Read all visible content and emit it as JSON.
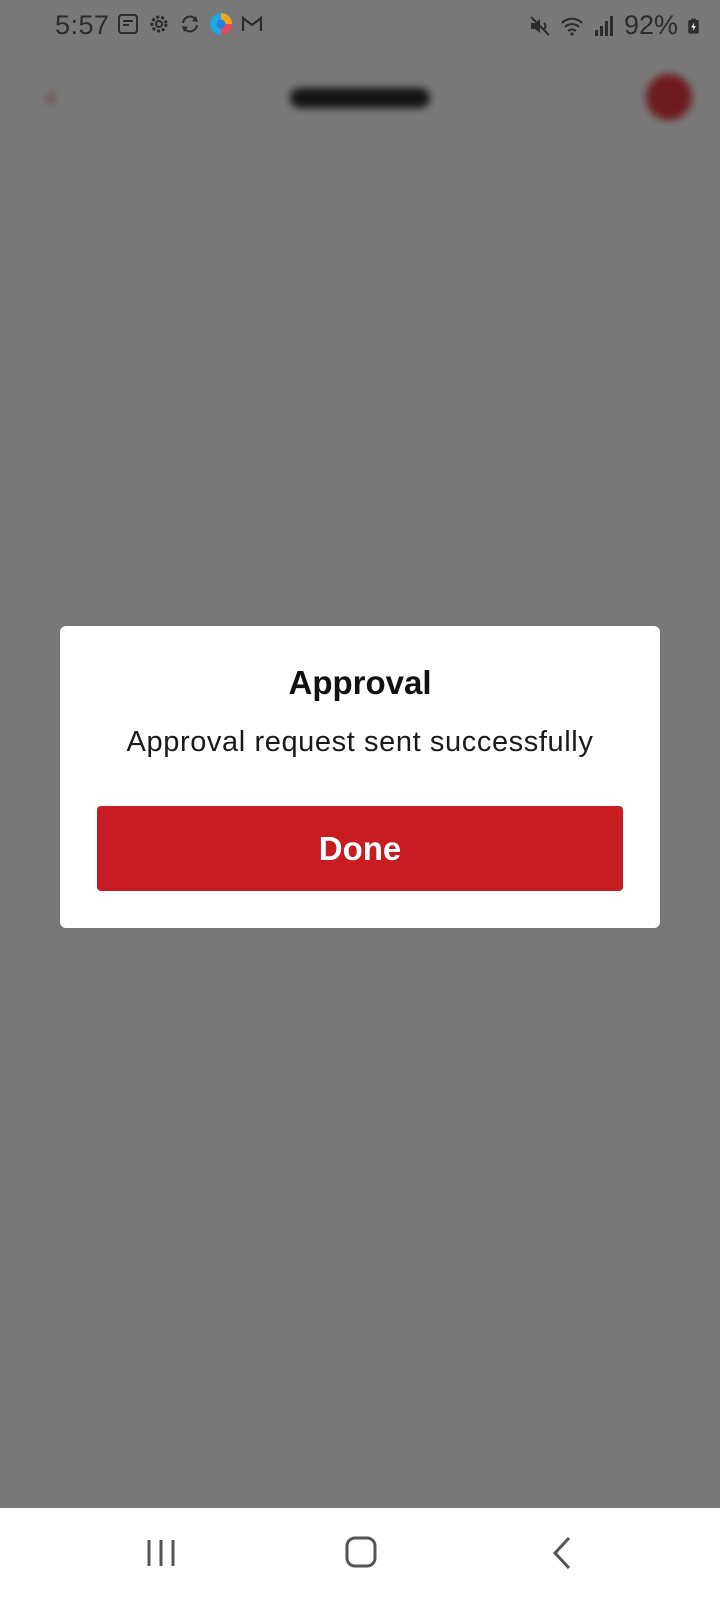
{
  "status_bar": {
    "time": "5:57",
    "battery": "92%",
    "left_icons": [
      "notes-icon",
      "settings-icon",
      "sync-icon",
      "browser-icon",
      "gmail-icon"
    ],
    "right_icons": [
      "mute-icon",
      "wifi-icon",
      "signal-icon",
      "battery-charging-icon"
    ]
  },
  "dialog": {
    "title": "Approval",
    "message": "Approval request sent successfully",
    "button_label": "Done"
  },
  "colors": {
    "accent": "#c61c22",
    "scrim": "rgba(0,0,0,0.53)",
    "dialog_bg": "#ffffff"
  },
  "nav_bar": {
    "buttons": [
      "recents-icon",
      "home-icon",
      "back-icon"
    ]
  }
}
